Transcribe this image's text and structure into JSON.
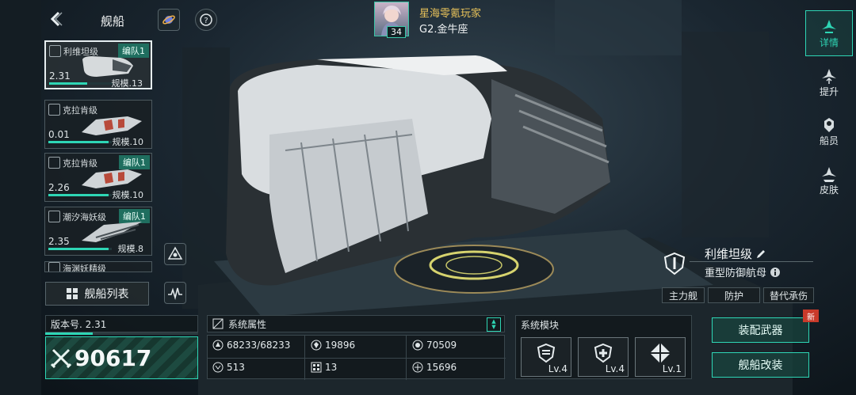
{
  "header": {
    "back_icon": "chevron-left",
    "title": "舰船",
    "planet_icon": "planet-icon",
    "help_icon": "help-icon"
  },
  "player": {
    "name": "星海零氪玩家",
    "rank": "G2.金牛座",
    "level": "34",
    "avatar_icon": "avatar"
  },
  "ship_list": [
    {
      "name": "利维坦级",
      "tag": "编队1",
      "version": "2.31",
      "scale": "规模.13",
      "progress": 0.6,
      "selected": true
    },
    {
      "name": "克拉肯级",
      "tag": "",
      "version": "0.01",
      "scale": "规模.10",
      "progress": 0.95,
      "selected": false
    },
    {
      "name": "克拉肯级",
      "tag": "编队1",
      "version": "2.26",
      "scale": "规模.10",
      "progress": 0.95,
      "selected": false
    },
    {
      "name": "潮汐海妖级",
      "tag": "编队1",
      "version": "2.35",
      "scale": "规模.8",
      "progress": 0.95,
      "selected": false
    },
    {
      "name": "海渊妖精级",
      "tag": "",
      "version": "",
      "scale": "",
      "progress": 0,
      "selected": false
    }
  ],
  "ship_list_button": {
    "label": "舰船列表"
  },
  "version_panel": {
    "label": "版本号. 2.31",
    "power": "90617"
  },
  "system_attributes": {
    "title": "系统属性",
    "cells": [
      {
        "icon": "hull-icon",
        "value": "68233/68233"
      },
      {
        "icon": "shield-icon",
        "value": "19896"
      },
      {
        "icon": "armor-icon",
        "value": "70509"
      },
      {
        "icon": "energy-icon",
        "value": "513"
      },
      {
        "icon": "grid-icon",
        "value": "13"
      },
      {
        "icon": "speed-icon",
        "value": "15696"
      }
    ]
  },
  "system_modules": {
    "title": "系统模块",
    "modules": [
      {
        "icon": "module-shield-icon",
        "level": "Lv.4"
      },
      {
        "icon": "module-medic-icon",
        "level": "Lv.4"
      },
      {
        "icon": "module-diamond-icon",
        "level": "Lv.1"
      }
    ]
  },
  "ship_info": {
    "name": "利维坦级",
    "type": "重型防御航母",
    "chips": [
      "主力舰",
      "防护",
      "替代承伤"
    ]
  },
  "side_tabs": [
    {
      "label": "详情",
      "active": true
    },
    {
      "label": "提升",
      "active": false
    },
    {
      "label": "船员",
      "active": false
    },
    {
      "label": "皮肤",
      "active": false
    }
  ],
  "actions": {
    "equip_weapon": "装配武器",
    "refit": "舰船改装",
    "new_badge": "新"
  },
  "colors": {
    "accent": "#2ed6b5",
    "badge": "#c93a2a",
    "gold": "#e8c25a"
  }
}
